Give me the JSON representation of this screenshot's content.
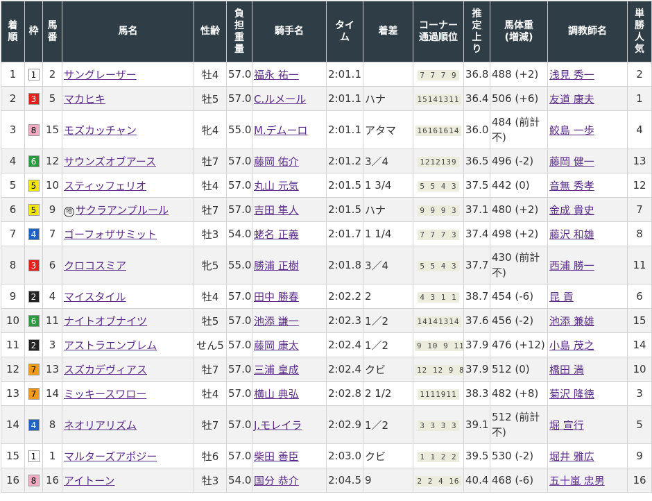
{
  "headers": [
    "着\n順",
    "枠",
    "馬\n番",
    "馬名",
    "性齢",
    "負\n担\n重\n量",
    "騎手名",
    "タイ\nム",
    "着差",
    "コーナー\n通過順位",
    "推\n定\n上\nり",
    "馬体重\n(増減)",
    "調教師名",
    "単\n勝\n人\n気"
  ],
  "waku_colors": {
    "1": {
      "bg": "#ffffff",
      "fg": "#000000"
    },
    "2": {
      "bg": "#222222",
      "fg": "#ffffff"
    },
    "3": {
      "bg": "#e0211c",
      "fg": "#ffffff"
    },
    "4": {
      "bg": "#1e62c8",
      "fg": "#ffffff"
    },
    "5": {
      "bg": "#f5e60a",
      "fg": "#000000"
    },
    "6": {
      "bg": "#2a9a3c",
      "fg": "#ffffff"
    },
    "7": {
      "bg": "#f39a18",
      "fg": "#000000"
    },
    "8": {
      "bg": "#f7a9c3",
      "fg": "#000000"
    }
  },
  "rows": [
    {
      "rank": "1",
      "waku": "1",
      "num": "2",
      "horse": "サングレーザー",
      "local": false,
      "sex_age": "牡4",
      "weight": "57.0",
      "jockey": "福永 祐一",
      "time": "2:01.1",
      "margin": "",
      "corner": "7 7 7 9",
      "last3f": "36.8",
      "body": "488 (+2)",
      "trainer": "浅見 秀一",
      "pop": "2"
    },
    {
      "rank": "2",
      "waku": "3",
      "num": "5",
      "horse": "マカヒキ",
      "local": false,
      "sex_age": "牡5",
      "weight": "57.0",
      "jockey": "C.ルメール",
      "time": "2:01.1",
      "margin": "ハナ",
      "corner": "15141311",
      "last3f": "36.4",
      "body": "506 (+6)",
      "trainer": "友道 康夫",
      "pop": "1"
    },
    {
      "rank": "3",
      "waku": "8",
      "num": "15",
      "horse": "モズカッチャン",
      "local": false,
      "sex_age": "牝4",
      "weight": "55.0",
      "jockey": "M.デムーロ",
      "time": "2:01.1",
      "margin": "アタマ",
      "corner": "16161614",
      "last3f": "36.0",
      "body": "484 (前計不)",
      "trainer": "鮫島 一歩",
      "pop": "4"
    },
    {
      "rank": "4",
      "waku": "6",
      "num": "12",
      "horse": "サウンズオブアース",
      "local": false,
      "sex_age": "牡7",
      "weight": "57.0",
      "jockey": "藤岡 佑介",
      "time": "2:01.2",
      "margin": "3／4",
      "corner": "1212139",
      "last3f": "36.5",
      "body": "496 (-2)",
      "trainer": "藤岡 健一",
      "pop": "13"
    },
    {
      "rank": "5",
      "waku": "5",
      "num": "10",
      "horse": "スティッフェリオ",
      "local": false,
      "sex_age": "牡4",
      "weight": "57.0",
      "jockey": "丸山 元気",
      "time": "2:01.5",
      "margin": "1 3/4",
      "corner": "5 5 4 3",
      "last3f": "37.5",
      "body": "442 (0)",
      "trainer": "音無 秀孝",
      "pop": "12"
    },
    {
      "rank": "6",
      "waku": "5",
      "num": "9",
      "horse": "サクラアンプルール",
      "local": true,
      "sex_age": "牡7",
      "weight": "57.0",
      "jockey": "吉田 隼人",
      "time": "2:01.5",
      "margin": "ハナ",
      "corner": "9 9 9 3",
      "last3f": "37.1",
      "body": "480 (+2)",
      "trainer": "金成 貴史",
      "pop": "7"
    },
    {
      "rank": "7",
      "waku": "4",
      "num": "7",
      "horse": "ゴーフォザサミット",
      "local": false,
      "sex_age": "牡3",
      "weight": "54.0",
      "jockey": "蛯名 正義",
      "time": "2:01.7",
      "margin": "1 1/4",
      "corner": "7 7 7 3",
      "last3f": "37.4",
      "body": "498 (+2)",
      "trainer": "藤沢 和雄",
      "pop": "8"
    },
    {
      "rank": "8",
      "waku": "3",
      "num": "6",
      "horse": "クロコスミア",
      "local": false,
      "sex_age": "牝5",
      "weight": "55.0",
      "jockey": "勝浦 正樹",
      "time": "2:01.8",
      "margin": "3／4",
      "corner": "5 5 4 3",
      "last3f": "37.7",
      "body": "430 (前計不)",
      "trainer": "西浦 勝一",
      "pop": "11"
    },
    {
      "rank": "9",
      "waku": "2",
      "num": "4",
      "horse": "マイスタイル",
      "local": false,
      "sex_age": "牡4",
      "weight": "57.0",
      "jockey": "田中 勝春",
      "time": "2:02.2",
      "margin": "2",
      "corner": "4 3 1 1",
      "last3f": "38.7",
      "body": "454 (-6)",
      "trainer": "昆 貢",
      "pop": "6"
    },
    {
      "rank": "10",
      "waku": "6",
      "num": "11",
      "horse": "ナイトオブナイツ",
      "local": false,
      "sex_age": "牡5",
      "weight": "57.0",
      "jockey": "池添 謙一",
      "time": "2:02.3",
      "margin": "1／2",
      "corner": "14141314",
      "last3f": "37.6",
      "body": "456 (-2)",
      "trainer": "池添 兼雄",
      "pop": "15"
    },
    {
      "rank": "11",
      "waku": "2",
      "num": "3",
      "horse": "アストラエンブレム",
      "local": false,
      "sex_age": "せん5",
      "weight": "57.0",
      "jockey": "藤岡 康太",
      "time": "2:02.4",
      "margin": "1／2",
      "corner": "9 10 9 11",
      "last3f": "37.9",
      "body": "476 (+12)",
      "trainer": "小島 茂之",
      "pop": "14"
    },
    {
      "rank": "12",
      "waku": "7",
      "num": "13",
      "horse": "スズカデヴィアス",
      "local": false,
      "sex_age": "牡7",
      "weight": "57.0",
      "jockey": "三浦 皇成",
      "time": "2:02.4",
      "margin": "クビ",
      "corner": "12 12 9 8",
      "last3f": "37.9",
      "body": "512 (0)",
      "trainer": "橋田 満",
      "pop": "10"
    },
    {
      "rank": "13",
      "waku": "7",
      "num": "14",
      "horse": "ミッキースワロー",
      "local": false,
      "sex_age": "牡4",
      "weight": "57.0",
      "jockey": "横山 典弘",
      "time": "2:02.8",
      "margin": "2 1/2",
      "corner": "1111911",
      "last3f": "38.3",
      "body": "482 (+8)",
      "trainer": "菊沢 隆徳",
      "pop": "3"
    },
    {
      "rank": "14",
      "waku": "4",
      "num": "8",
      "horse": "ネオリアリズム",
      "local": false,
      "sex_age": "牡7",
      "weight": "57.0",
      "jockey": "J.モレイラ",
      "time": "2:02.9",
      "margin": "1／2",
      "corner": "3 3 3 3",
      "last3f": "39.1",
      "body": "512 (前計不)",
      "trainer": "堀 宣行",
      "pop": "5"
    },
    {
      "rank": "15",
      "waku": "1",
      "num": "1",
      "horse": "マルターズアポジー",
      "local": false,
      "sex_age": "牡6",
      "weight": "57.0",
      "jockey": "柴田 善臣",
      "time": "2:03.0",
      "margin": "クビ",
      "corner": "1 1 2 2",
      "last3f": "39.5",
      "body": "530 (-2)",
      "trainer": "堀井 雅広",
      "pop": "9"
    },
    {
      "rank": "16",
      "waku": "8",
      "num": "16",
      "horse": "アイトーン",
      "local": false,
      "sex_age": "牡3",
      "weight": "54.0",
      "jockey": "国分 恭介",
      "time": "2:04.5",
      "margin": "9",
      "corner": "2 2 4 16",
      "last3f": "40.4",
      "body": "468 (-6)",
      "trainer": "五十嵐 忠男",
      "pop": "16"
    }
  ]
}
